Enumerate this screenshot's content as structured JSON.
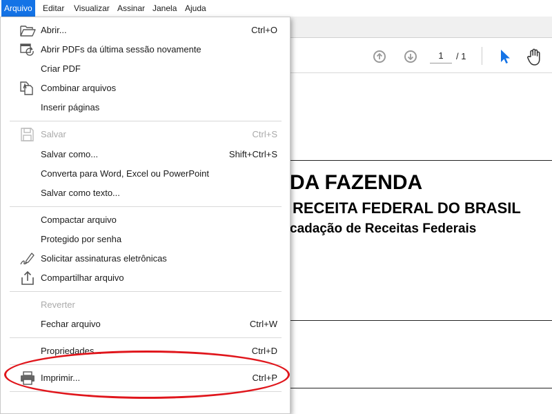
{
  "menubar": {
    "items": [
      {
        "label": "Arquivo"
      },
      {
        "label": "Editar"
      },
      {
        "label": "Visualizar"
      },
      {
        "label": "Assinar"
      },
      {
        "label": "Janela"
      },
      {
        "label": "Ajuda"
      }
    ]
  },
  "toolbar": {
    "page_current": "1",
    "page_total": "/ 1",
    "icons": [
      "prev-page-icon",
      "next-page-icon",
      "select-cursor-icon",
      "hand-tool-icon"
    ]
  },
  "document": {
    "line1": "DA FAZENDA",
    "line2": "RECEITA FEDERAL DO BRASIL",
    "line3": "cadação de Receitas Federais"
  },
  "file_menu": {
    "items": [
      {
        "label": "Abrir...",
        "shortcut": "Ctrl+O",
        "icon": "folder-open-icon"
      },
      {
        "label": "Abrir PDFs da última sessão novamente",
        "shortcut": "",
        "icon": "reopen-session-icon"
      },
      {
        "label": "Criar PDF",
        "shortcut": ""
      },
      {
        "label": "Combinar arquivos",
        "shortcut": "",
        "icon": "combine-files-icon"
      },
      {
        "label": "Inserir páginas",
        "shortcut": ""
      },
      {
        "label": "Salvar",
        "shortcut": "Ctrl+S",
        "icon": "save-icon",
        "disabled": true
      },
      {
        "label": "Salvar como...",
        "shortcut": "Shift+Ctrl+S"
      },
      {
        "label": "Converta para Word, Excel ou PowerPoint",
        "shortcut": ""
      },
      {
        "label": "Salvar como texto...",
        "shortcut": ""
      },
      {
        "label": "Compactar arquivo",
        "shortcut": ""
      },
      {
        "label": "Protegido por senha",
        "shortcut": ""
      },
      {
        "label": "Solicitar assinaturas eletrônicas",
        "shortcut": "",
        "icon": "signature-pen-icon"
      },
      {
        "label": "Compartilhar arquivo",
        "shortcut": "",
        "icon": "share-icon"
      },
      {
        "label": "Reverter",
        "shortcut": "",
        "disabled": true
      },
      {
        "label": "Fechar arquivo",
        "shortcut": "Ctrl+W"
      },
      {
        "label": "Propriedades...",
        "shortcut": "Ctrl+D"
      },
      {
        "label": "Imprimir...",
        "shortcut": "Ctrl+P",
        "icon": "printer-icon"
      }
    ]
  },
  "annotation": {
    "color": "#e0161c",
    "target": "Imprimir..."
  }
}
